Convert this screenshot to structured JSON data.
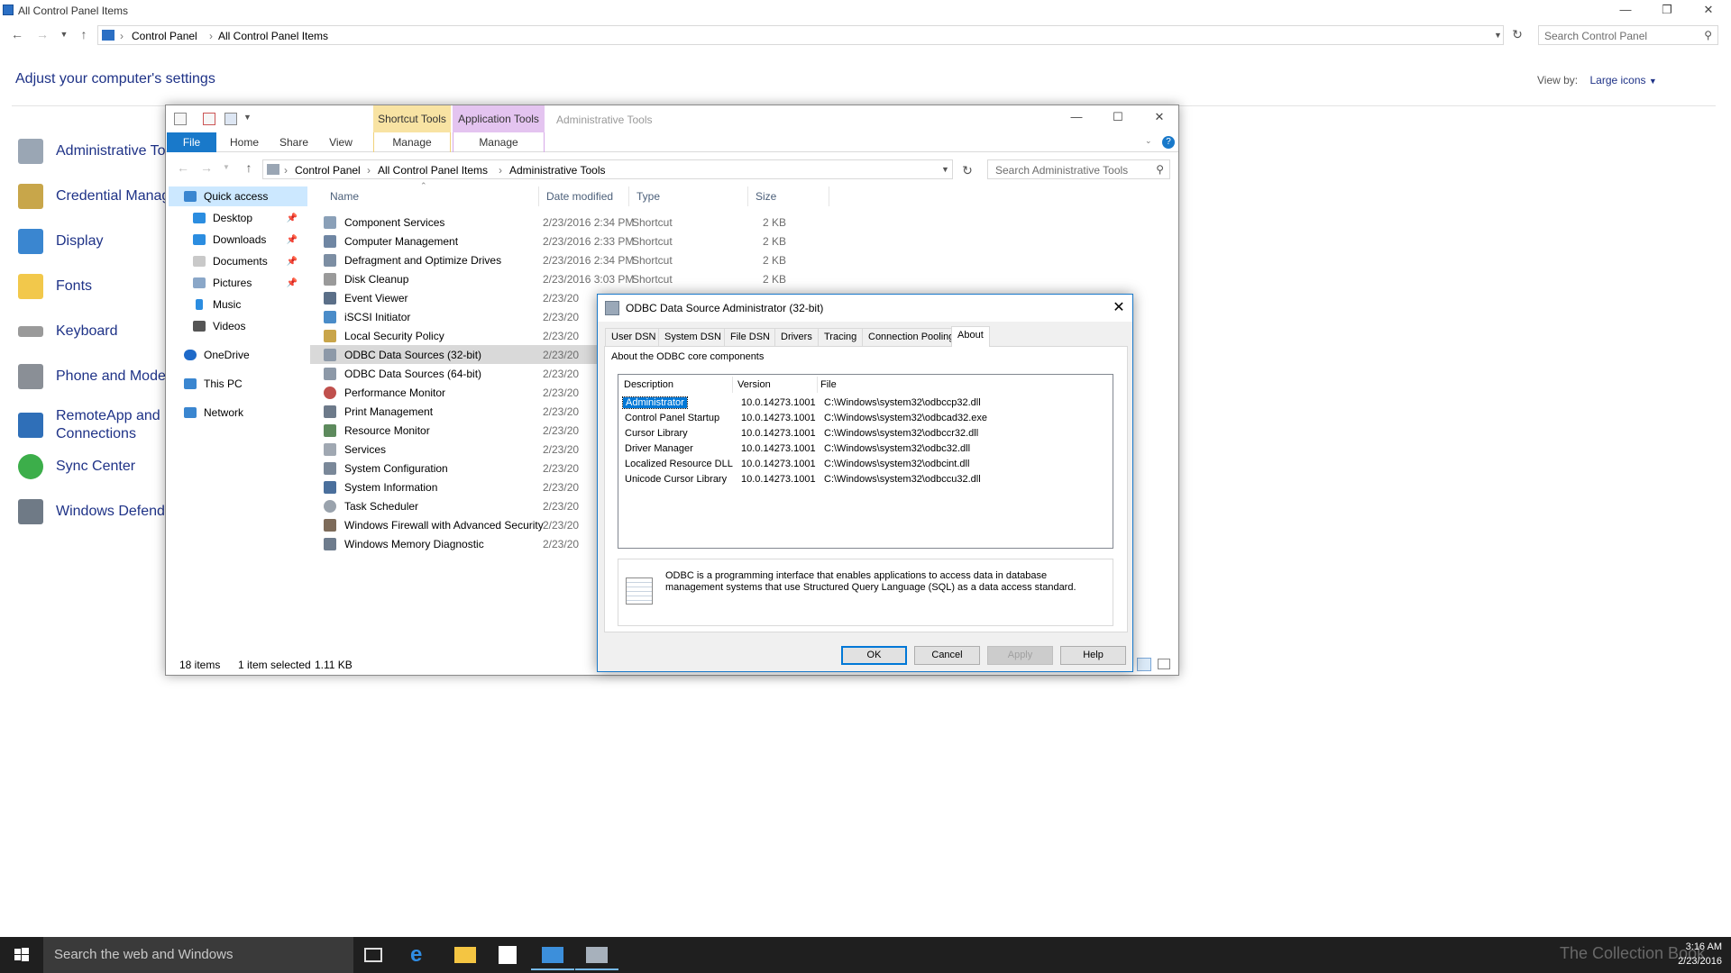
{
  "cp_window": {
    "title": "All Control Panel Items",
    "breadcrumb": [
      "Control Panel",
      "All Control Panel Items"
    ],
    "search_placeholder": "Search Control Panel",
    "heading": "Adjust your computer's settings",
    "view_by_label": "View by:",
    "view_by_value": "Large icons",
    "items": [
      {
        "label": "Administrative To",
        "icon": "admin-tools-icon"
      },
      {
        "label": "Credential Manag",
        "icon": "credential-icon"
      },
      {
        "label": "Display",
        "icon": "display-icon"
      },
      {
        "label": "Fonts",
        "icon": "fonts-icon"
      },
      {
        "label": "Keyboard",
        "icon": "keyboard-icon"
      },
      {
        "label": "Phone and Moder",
        "icon": "phone-modem-icon"
      },
      {
        "label": "RemoteApp and D\nConnections",
        "icon": "remoteapp-icon"
      },
      {
        "label": "Sync Center",
        "icon": "sync-icon"
      },
      {
        "label": "Windows Defende",
        "icon": "defender-icon"
      }
    ]
  },
  "explorer": {
    "contextual_headers": [
      "Shortcut Tools",
      "Application Tools"
    ],
    "title": "Administrative Tools",
    "ribbon_tabs": [
      "File",
      "Home",
      "Share",
      "View",
      "Manage",
      "Manage"
    ],
    "breadcrumb": [
      "Control Panel",
      "All Control Panel Items",
      "Administrative Tools"
    ],
    "search_placeholder": "Search Administrative Tools",
    "nav": {
      "quick_access": "Quick access",
      "pinned": [
        "Desktop",
        "Downloads",
        "Documents",
        "Pictures"
      ],
      "others": [
        "Music",
        "Videos"
      ],
      "onedrive": "OneDrive",
      "this_pc": "This PC",
      "network": "Network"
    },
    "columns": [
      "Name",
      "Date modified",
      "Type",
      "Size"
    ],
    "files": [
      {
        "name": "Component Services",
        "date": "2/23/2016 2:34 PM",
        "type": "Shortcut",
        "size": "2 KB"
      },
      {
        "name": "Computer Management",
        "date": "2/23/2016 2:33 PM",
        "type": "Shortcut",
        "size": "2 KB"
      },
      {
        "name": "Defragment and Optimize Drives",
        "date": "2/23/2016 2:34 PM",
        "type": "Shortcut",
        "size": "2 KB"
      },
      {
        "name": "Disk Cleanup",
        "date": "2/23/2016 3:03 PM",
        "type": "Shortcut",
        "size": "2 KB"
      },
      {
        "name": "Event Viewer",
        "date": "2/23/20"
      },
      {
        "name": "iSCSI Initiator",
        "date": "2/23/20"
      },
      {
        "name": "Local Security Policy",
        "date": "2/23/20"
      },
      {
        "name": "ODBC Data Sources (32-bit)",
        "date": "2/23/20"
      },
      {
        "name": "ODBC Data Sources (64-bit)",
        "date": "2/23/20"
      },
      {
        "name": "Performance Monitor",
        "date": "2/23/20"
      },
      {
        "name": "Print Management",
        "date": "2/23/20"
      },
      {
        "name": "Resource Monitor",
        "date": "2/23/20"
      },
      {
        "name": "Services",
        "date": "2/23/20"
      },
      {
        "name": "System Configuration",
        "date": "2/23/20"
      },
      {
        "name": "System Information",
        "date": "2/23/20"
      },
      {
        "name": "Task Scheduler",
        "date": "2/23/20"
      },
      {
        "name": "Windows Firewall with Advanced Security",
        "date": "2/23/20"
      },
      {
        "name": "Windows Memory Diagnostic",
        "date": "2/23/20"
      }
    ],
    "status": {
      "count": "18 items",
      "selected": "1 item selected",
      "size": "1.11 KB"
    }
  },
  "dialog": {
    "title": "ODBC Data Source Administrator (32-bit)",
    "tabs": [
      "User DSN",
      "System DSN",
      "File DSN",
      "Drivers",
      "Tracing",
      "Connection Pooling",
      "About"
    ],
    "about_label": "About the ODBC core components",
    "list_headers": [
      "Description",
      "Version",
      "File"
    ],
    "components": [
      {
        "desc": "Administrator",
        "ver": "10.0.14273.1001",
        "file": "C:\\Windows\\system32\\odbccp32.dll"
      },
      {
        "desc": "Control Panel Startup",
        "ver": "10.0.14273.1001",
        "file": "C:\\Windows\\system32\\odbcad32.exe"
      },
      {
        "desc": "Cursor Library",
        "ver": "10.0.14273.1001",
        "file": "C:\\Windows\\system32\\odbccr32.dll"
      },
      {
        "desc": "Driver Manager",
        "ver": "10.0.14273.1001",
        "file": "C:\\Windows\\system32\\odbc32.dll"
      },
      {
        "desc": "Localized Resource DLL",
        "ver": "10.0.14273.1001",
        "file": "C:\\Windows\\system32\\odbcint.dll"
      },
      {
        "desc": "Unicode Cursor Library",
        "ver": "10.0.14273.1001",
        "file": "C:\\Windows\\system32\\odbccu32.dll"
      }
    ],
    "info_text": "ODBC is a programming interface that enables applications to access data in database management systems that use Structured Query Language (SQL) as a data access standard.",
    "buttons": {
      "ok": "OK",
      "cancel": "Cancel",
      "apply": "Apply",
      "help": "Help"
    }
  },
  "taskbar": {
    "search_placeholder": "Search the web and Windows",
    "time": "3:16 AM",
    "date": "2/23/2016",
    "watermark": "The Collection Book"
  },
  "colors": {
    "accent": "#0078d7",
    "link": "#1e3287",
    "shortcut_tools": "#f8e3a3",
    "application_tools": "#e4c4f0"
  }
}
